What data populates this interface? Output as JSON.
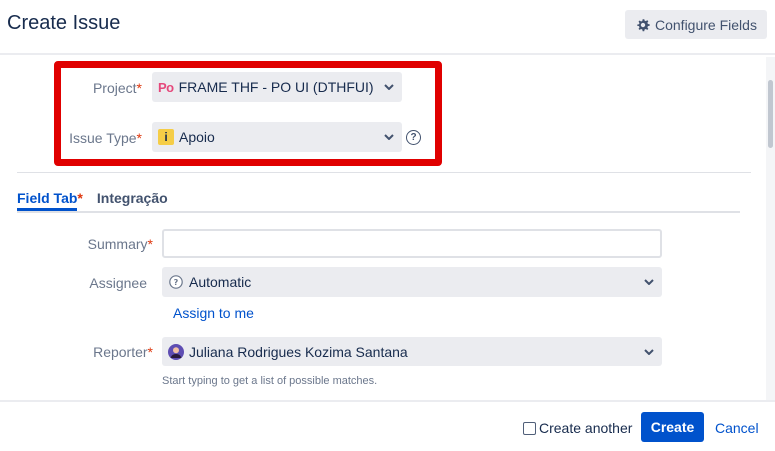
{
  "header": {
    "title": "Create Issue",
    "configure_label": "Configure Fields"
  },
  "project": {
    "label": "Project",
    "required": "*",
    "value": "FRAME THF - PO UI (DTHFUI)",
    "icon_text": "Po"
  },
  "issue_type": {
    "label": "Issue Type",
    "required": "*",
    "value": "Apoio",
    "help": "?"
  },
  "tabs": [
    {
      "label": "Field Tab",
      "required": "*"
    },
    {
      "label": "Integração"
    }
  ],
  "summary": {
    "label": "Summary",
    "required": "*",
    "value": ""
  },
  "assignee": {
    "label": "Assignee",
    "value": "Automatic",
    "assign_link": "Assign to me"
  },
  "reporter": {
    "label": "Reporter",
    "required": "*",
    "value": "Juliana Rodrigues Kozima Santana",
    "hint": "Start typing to get a list of possible matches."
  },
  "footer": {
    "create_another_label": "Create another",
    "create_label": "Create",
    "cancel_label": "Cancel"
  },
  "colors": {
    "accent": "#0052cc",
    "highlight": "#e00000",
    "required": "#de350b",
    "project_icon": "#e5487b",
    "issue_icon": "#f5cd47"
  }
}
